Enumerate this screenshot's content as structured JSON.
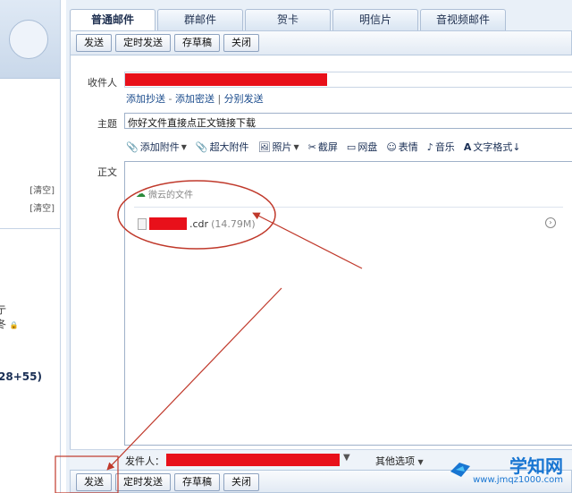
{
  "left_panel": {
    "clear_labels": [
      "[清空]",
      "[清空]"
    ],
    "user_char": "亍",
    "user_suffix": "冬",
    "count_text": "28+55)"
  },
  "tabs": [
    {
      "label": "普通邮件",
      "active": true
    },
    {
      "label": "群邮件",
      "active": false
    },
    {
      "label": "贺卡",
      "active": false
    },
    {
      "label": "明信片",
      "active": false
    },
    {
      "label": "音视频邮件",
      "active": false
    }
  ],
  "toolbar": {
    "send": "发送",
    "scheduled": "定时发送",
    "draft": "存草稿",
    "close": "关闭"
  },
  "form": {
    "to_label": "收件人",
    "add_cc": "添加抄送",
    "sep1": " - ",
    "add_bcc": "添加密送",
    "sep2": " | ",
    "separate_send": "分别发送",
    "subject_label": "主题",
    "subject_value": "你好文件直接点正文链接下载",
    "body_label": "正文"
  },
  "attach_bar": {
    "add_attachment": "添加附件",
    "super_attachment": "超大附件",
    "photos": "照片",
    "screenshot": "截屏",
    "netdisk": "网盘",
    "emoji": "表情",
    "music": "音乐",
    "text_format": "文字格式↓"
  },
  "body": {
    "cloud_title": "微云的文件",
    "file_ext": ".cdr",
    "file_size": "(14.79M)"
  },
  "footer": {
    "sender_label": "发件人：",
    "more_options": "其他选项"
  },
  "watermark": {
    "brand": "学知网",
    "url": "www.jmqz1000.com"
  },
  "colors": {
    "redaction": "#e8101a",
    "annotation": "#c0392b",
    "link": "#1a4b8c"
  }
}
